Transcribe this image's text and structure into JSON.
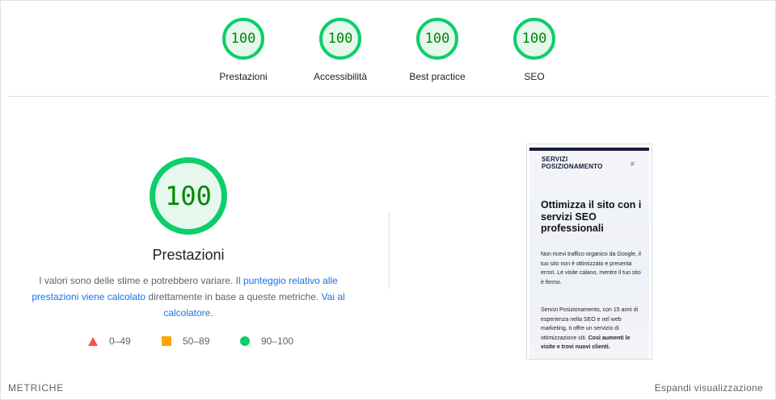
{
  "categories": [
    {
      "score": "100",
      "label": "Prestazioni"
    },
    {
      "score": "100",
      "label": "Accessibilità"
    },
    {
      "score": "100",
      "label": "Best practice"
    },
    {
      "score": "100",
      "label": "SEO"
    }
  ],
  "performance": {
    "score": "100",
    "title": "Prestazioni",
    "desc_part1": "I valori sono delle stime e potrebbero variare. Il ",
    "desc_link1": "punteggio relativo alle prestazioni viene calcolato",
    "desc_part2": " direttamente in base a queste metriche. ",
    "desc_link2": "Vai al calcolatore",
    "desc_part3": "."
  },
  "legend": {
    "fail": "0–49",
    "average": "50–89",
    "pass": "90–100"
  },
  "thumbnail": {
    "logo_line1": "SERVIZI",
    "logo_line2": "POSIZIONAMENTO",
    "menu": "≡",
    "headline": "Ottimizza il sito con i servizi SEO professionali",
    "para1": "Non ricevi traffico organico da Google, il tuo sito non è ottimizzato e presenta errori. Le visite calano, mentre il tuo sito è fermo.",
    "para2": "Servizi Posizionamento, con 15 anni di esperienza nella SEO e nel web marketing, ti offre un servizio di ottimizzazione siti.",
    "para2_bold": "Così aumenti le visite e trovi nuovi clienti."
  },
  "footer": {
    "metrics_label": "METRICHE",
    "expand_label": "Espandi visualizzazione"
  },
  "colors": {
    "pass": "#0cce6b",
    "pass_text": "#008800",
    "pass_bg": "#e6f7ee",
    "average": "#ffa400",
    "fail": "#ff4e42",
    "link": "#1a73e8"
  }
}
